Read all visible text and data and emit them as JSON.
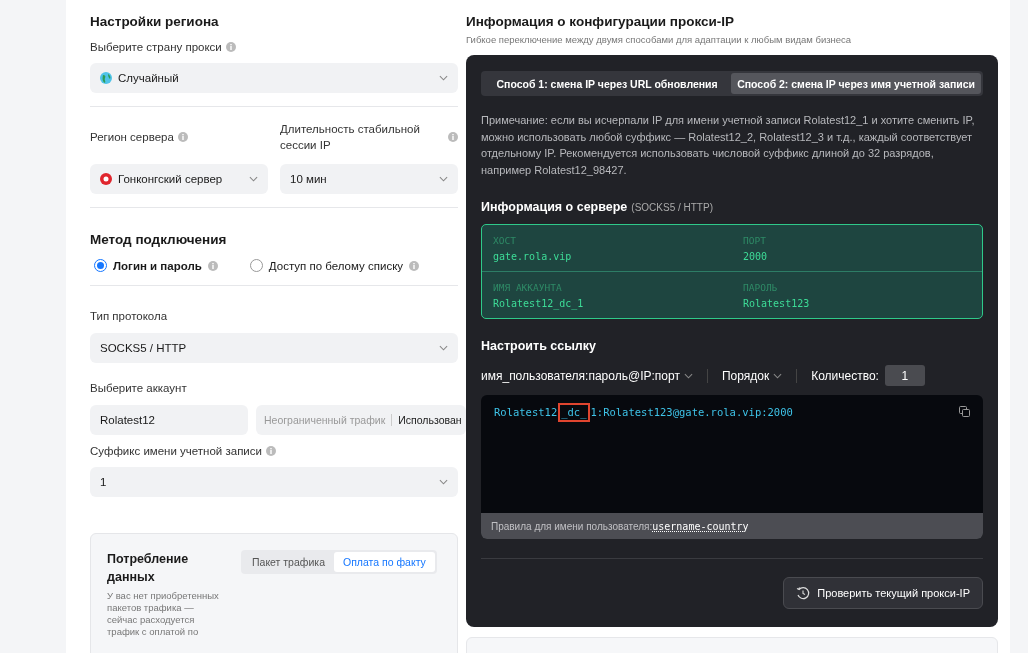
{
  "region_settings": {
    "title": "Настройки региона",
    "country": {
      "label": "Выберите страну прокси",
      "value": "Случайный"
    },
    "server_region": {
      "label": "Регион сервера",
      "value": "Гонконгский сервер"
    },
    "session_duration": {
      "label": "Длительность стабильной сессии IP",
      "value": "10 мин"
    }
  },
  "connection": {
    "title": "Метод подключения",
    "options": [
      {
        "label": "Логин и пароль",
        "selected": true
      },
      {
        "label": "Доступ по белому списку",
        "selected": false
      }
    ]
  },
  "protocol": {
    "label": "Тип протокола",
    "value": "SOCKS5 / HTTP"
  },
  "account": {
    "label": "Выберите аккаунт",
    "value": "Rolatest12",
    "traffic": "Неограниченный трафик",
    "used": "Использован"
  },
  "suffix": {
    "label": "Суффикс имени учетной записи",
    "value": "1"
  },
  "consumption": {
    "title": "Потребление данных",
    "text": "У вас нет приобретенных пакетов трафика — сейчас расходуется трафик с оплатой по",
    "modes": [
      {
        "label": "Пакет трафика",
        "selected": false
      },
      {
        "label": "Оплата по факту",
        "selected": true
      }
    ]
  },
  "config": {
    "title": "Информация о конфигурации прокси-IP",
    "subtitle": "Гибкое переключение между двумя способами для адаптации к любым видам бизнеса",
    "tabs": [
      {
        "label": "Способ 1: смена IP через URL обновления",
        "selected": false
      },
      {
        "label": "Способ 2: смена IP через имя учетной записи",
        "selected": true
      }
    ],
    "note": "Примечание: если вы исчерпали IP для имени учетной записи Rolatest12_1 и хотите сменить IP, можно использовать любой суффикс — Rolatest12_2, Rolatest12_3 и т.д., каждый соответствует отдельному IP. Рекомендуется использовать числовой суффикс длиной до 32 разрядов, например Rolatest12_98427.",
    "server_title": "Информация о сервере",
    "server_protocol": "(SOCKS5 / HTTP)",
    "server_fields": [
      {
        "label": "ХОСТ",
        "value": "gate.rola.vip"
      },
      {
        "label": "ПОРТ",
        "value": "2000"
      },
      {
        "label": "ИМЯ АККАУНТА",
        "value": "Rolatest12_dc_1"
      },
      {
        "label": "ПАРОЛЬ",
        "value": "Rolatest123"
      }
    ],
    "link_title": "Настроить ссылку",
    "format": "имя_пользователя:пароль@IP:порт",
    "order": "Порядок",
    "quantity_label": "Количество:",
    "quantity": "1",
    "link_parts": [
      "Rolatest12",
      "_dc_",
      "1:Rolatest123@gate.rola.vip:2000"
    ],
    "rules_label": "Правила для имени пользователя:",
    "rules_value": "username-country",
    "check_button": "Проверить текущий прокси-IP"
  }
}
